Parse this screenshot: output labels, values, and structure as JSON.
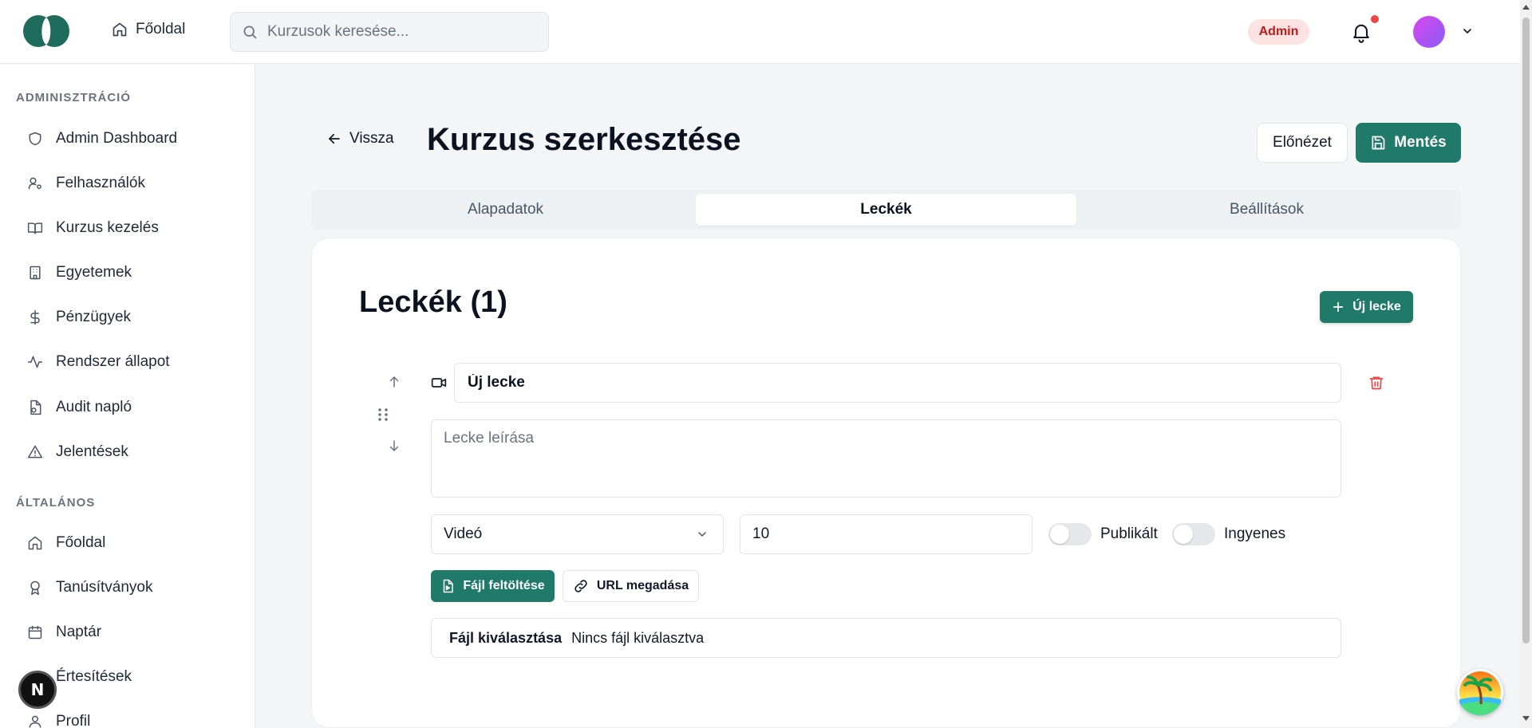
{
  "header": {
    "home_label": "Főoldal",
    "search_placeholder": "Kurzusok keresése...",
    "role_badge": "Admin"
  },
  "sidebar": {
    "admin_section": "ADMINISZTRÁCIÓ",
    "admin_items": [
      {
        "label": "Admin Dashboard",
        "icon": "shield-icon"
      },
      {
        "label": "Felhasználók",
        "icon": "user-cog-icon"
      },
      {
        "label": "Kurzus kezelés",
        "icon": "book-open-icon"
      },
      {
        "label": "Egyetemek",
        "icon": "building-icon"
      },
      {
        "label": "Pénzügyek",
        "icon": "dollar-icon"
      },
      {
        "label": "Rendszer állapot",
        "icon": "activity-icon"
      },
      {
        "label": "Audit napló",
        "icon": "file-audit-icon"
      },
      {
        "label": "Jelentések",
        "icon": "alert-triangle-icon"
      }
    ],
    "general_section": "ÁLTALÁNOS",
    "general_items": [
      {
        "label": "Főoldal",
        "icon": "home-icon"
      },
      {
        "label": "Tanúsítványok",
        "icon": "award-icon"
      },
      {
        "label": "Naptár",
        "icon": "calendar-icon"
      },
      {
        "label": "Értesítések",
        "icon": "bell-icon"
      },
      {
        "label": "Profil",
        "icon": "user-icon"
      }
    ]
  },
  "page": {
    "back_label": "Vissza",
    "title": "Kurzus szerkesztése",
    "preview_label": "Előnézet",
    "save_label": "Mentés",
    "tabs": [
      {
        "label": "Alapadatok",
        "active": false
      },
      {
        "label": "Leckék",
        "active": true
      },
      {
        "label": "Beállítások",
        "active": false
      }
    ]
  },
  "lessons": {
    "heading": "Leckék (1)",
    "new_lesson_label": "Új lecke",
    "items": [
      {
        "title_value": "Új lecke",
        "description_placeholder": "Lecke leírása",
        "type_value": "Videó",
        "duration_value": "10",
        "published_label": "Publikált",
        "published": false,
        "free_label": "Ingyenes",
        "free": false,
        "upload_label": "Fájl feltöltése",
        "url_label": "URL megadása",
        "file_button": "Fájl kiválasztása",
        "file_status": "Nincs fájl kiválasztva"
      }
    ]
  },
  "colors": {
    "accent": "#1f7a6a",
    "danger": "#ef4444",
    "badge_bg": "#fde2e2"
  }
}
